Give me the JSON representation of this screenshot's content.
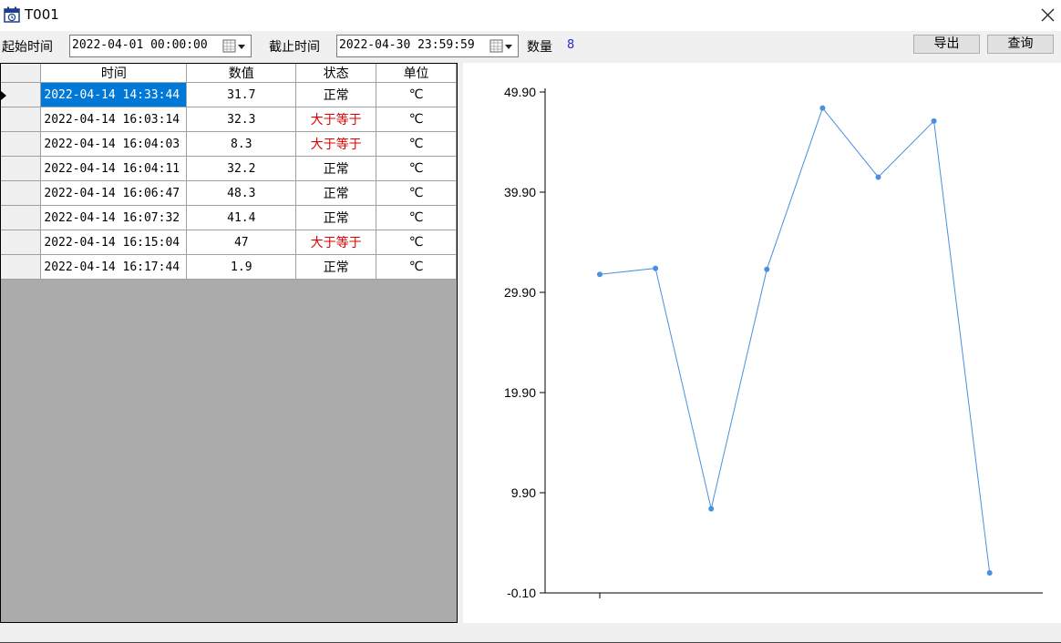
{
  "window": {
    "title": "T001",
    "icon": "calendar-clock-icon",
    "close_icon": "close-icon"
  },
  "toolbar": {
    "start_label": "起始时间",
    "start_value": "2022-04-01 00:00:00",
    "end_label": "截止时间",
    "end_value": "2022-04-30 23:59:59",
    "count_label": "数量",
    "count_value": "8",
    "export_label": "导出",
    "query_label": "查询",
    "calendar_icon": "calendar-dropdown-icon"
  },
  "table": {
    "headers": [
      "时间",
      "数值",
      "状态",
      "单位"
    ],
    "rows": [
      {
        "time": "2022-04-14 14:33:44",
        "value": "31.7",
        "status": "正常",
        "unit": "℃"
      },
      {
        "time": "2022-04-14 16:03:14",
        "value": "32.3",
        "status": "大于等于",
        "unit": "℃"
      },
      {
        "time": "2022-04-14 16:04:03",
        "value": "8.3",
        "status": "大于等于",
        "unit": "℃"
      },
      {
        "time": "2022-04-14 16:04:11",
        "value": "32.2",
        "status": "正常",
        "unit": "℃"
      },
      {
        "time": "2022-04-14 16:06:47",
        "value": "48.3",
        "status": "正常",
        "unit": "℃"
      },
      {
        "time": "2022-04-14 16:07:32",
        "value": "41.4",
        "status": "正常",
        "unit": "℃"
      },
      {
        "time": "2022-04-14 16:15:04",
        "value": "47",
        "status": "大于等于",
        "unit": "℃"
      },
      {
        "time": "2022-04-14 16:17:44",
        "value": "1.9",
        "status": "正常",
        "unit": "℃"
      }
    ],
    "selected_row": 0
  },
  "colors": {
    "alarm_text": "#e00000",
    "selection": "#0078d7",
    "line": "#4a8fe0",
    "count": "#2a2ad0"
  },
  "chart_data": {
    "type": "line",
    "y_ticks": [
      "49.90",
      "39.90",
      "29.90",
      "19.90",
      "9.90",
      "-0.10"
    ],
    "ylim": [
      -0.1,
      49.9
    ],
    "series": [
      {
        "values": [
          31.7,
          32.3,
          8.3,
          32.2,
          48.3,
          41.4,
          47,
          1.9
        ]
      }
    ]
  }
}
